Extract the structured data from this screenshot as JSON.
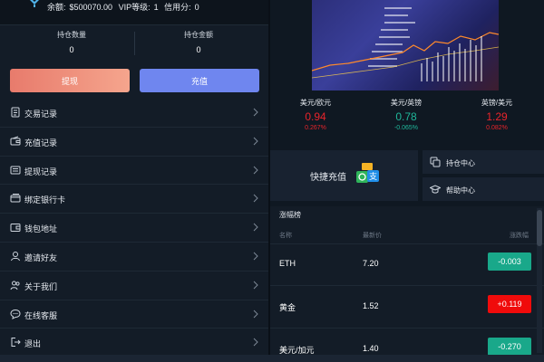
{
  "topbar": {
    "balance_label": "余额:",
    "balance_value": "$500070.00",
    "vip_label": "VIP等级:",
    "vip_value": "1",
    "credit_label": "信用分:",
    "credit_value": "0"
  },
  "holdings": {
    "qty_label": "持仓数量",
    "qty_value": "0",
    "amount_label": "持仓金额",
    "amount_value": "0"
  },
  "actions": {
    "withdraw_label": "提现",
    "deposit_label": "充值"
  },
  "menu": [
    {
      "label": "交易记录",
      "icon": "document-icon"
    },
    {
      "label": "充值记录",
      "icon": "wallet-in-icon"
    },
    {
      "label": "提现记录",
      "icon": "list-icon"
    },
    {
      "label": "绑定银行卡",
      "icon": "bank-card-icon"
    },
    {
      "label": "钱包地址",
      "icon": "wallet-icon"
    },
    {
      "label": "邀请好友",
      "icon": "user-icon"
    },
    {
      "label": "关于我们",
      "icon": "users-icon"
    },
    {
      "label": "在线客服",
      "icon": "chat-icon"
    },
    {
      "label": "退出",
      "icon": "logout-icon"
    }
  ],
  "rates": [
    {
      "pair": "美元/欧元",
      "price": "0.94",
      "change": "0.267%",
      "color": "#e8242b"
    },
    {
      "pair": "美元/英镑",
      "price": "0.78",
      "change": "-0.065%",
      "color": "#1fb79a"
    },
    {
      "pair": "英镑/美元",
      "price": "1.29",
      "change": "0.082%",
      "color": "#e8242b"
    }
  ],
  "quick": {
    "label": "快捷充值"
  },
  "side_buttons": [
    {
      "label": "持仓中心",
      "icon": "copy-icon"
    },
    {
      "label": "帮助中心",
      "icon": "graduation-cap-icon"
    }
  ],
  "ranks": {
    "title": "涨幅榜",
    "headers": {
      "name": "名称",
      "last": "最新价",
      "change": "涨跌幅"
    },
    "rows": [
      {
        "name": "ETH",
        "last": "7.20",
        "change": "-0.003",
        "color": "#19a88a"
      },
      {
        "name": "黄金",
        "last": "1.52",
        "change": "+0.119",
        "color": "#f00b0b"
      },
      {
        "name": "美元/加元",
        "last": "1.40",
        "change": "-0.270",
        "color": "#19a88a"
      }
    ]
  },
  "colors": {
    "background": "#0f1822",
    "panel": "#131c27",
    "up": "#e8242b",
    "down": "#1fb79a"
  }
}
